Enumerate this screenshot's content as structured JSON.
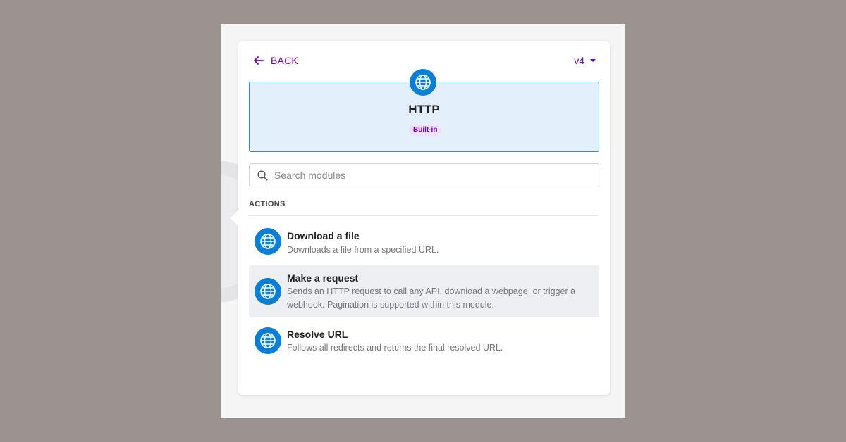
{
  "header": {
    "back_label": "BACK",
    "version_label": "v4"
  },
  "app": {
    "name": "HTTP",
    "badge": "Built-in",
    "icon": "globe-icon"
  },
  "search": {
    "placeholder": "Search modules",
    "value": ""
  },
  "sections": [
    {
      "label": "ACTIONS",
      "modules": [
        {
          "title": "Download a file",
          "description": "Downloads a file from a specified URL.",
          "icon": "globe-icon"
        },
        {
          "title": "Make a request",
          "description": "Sends an HTTP request to call any API, download a webpage, or trigger a webhook. Pagination is supported within this module.",
          "icon": "globe-icon",
          "hovered": true
        },
        {
          "title": "Resolve URL",
          "description": "Follows all redirects and returns the final resolved URL.",
          "icon": "globe-icon"
        }
      ]
    }
  ],
  "colors": {
    "accent": "#6d00cc",
    "icon_blue": "#0a7fd8",
    "card_bg": "#e3f0fb",
    "card_border": "#2b8ae0",
    "backdrop": "#9a9390"
  }
}
